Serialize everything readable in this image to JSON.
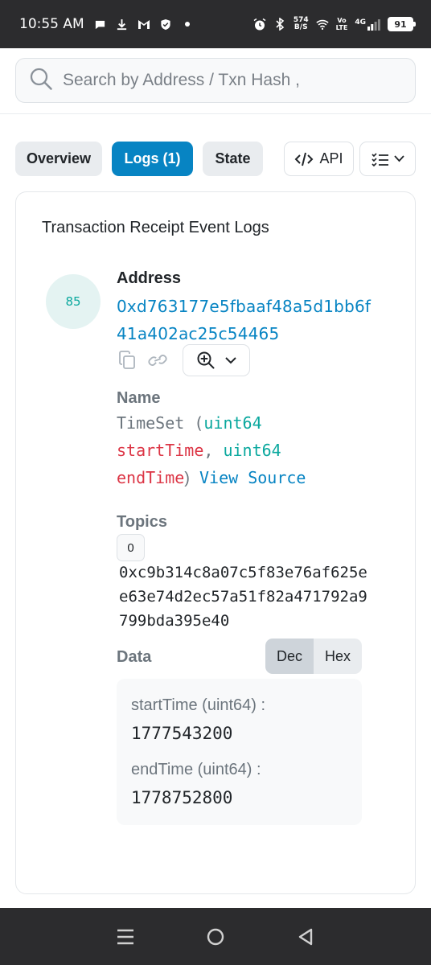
{
  "status_bar": {
    "time": "10:55 AM",
    "net_speed_value": "574",
    "net_speed_unit": "B/S",
    "volte_top": "Vo",
    "volte_bottom": "LTE",
    "network": "4G",
    "battery": "91"
  },
  "search": {
    "placeholder": "Search by Address / Txn Hash ,"
  },
  "tabs": {
    "overview": "Overview",
    "logs": "Logs (1)",
    "state": "State",
    "api": "API"
  },
  "card": {
    "title": "Transaction Receipt Event Logs",
    "log_index": "85",
    "address_label": "Address",
    "address_value": "0xd763177e5fbaaf48a5d1bb6f41a402ac25c54465",
    "name_label": "Name",
    "event_name": "TimeSet (",
    "param1_type": "uint64",
    "param1_name": "startTime",
    "comma": ",",
    "param2_type": "uint64",
    "param2_name": "endTime",
    "close_paren": ")",
    "view_source": "View Source",
    "topics_label": "Topics",
    "topic_index": "0",
    "topic_value": "0xc9b314c8a07c5f83e76af625ee63e74d2ec57a51f82a471792a9799bda395e40",
    "data_label": "Data",
    "dec_label": "Dec",
    "hex_label": "Hex",
    "data_items": [
      {
        "key": "startTime (uint64) :",
        "value": "1777543200"
      },
      {
        "key": "endTime (uint64) :",
        "value": "1778752800"
      }
    ]
  },
  "colors": {
    "primary": "#0784c3",
    "green": "#0aa89e",
    "red": "#dc3545"
  }
}
